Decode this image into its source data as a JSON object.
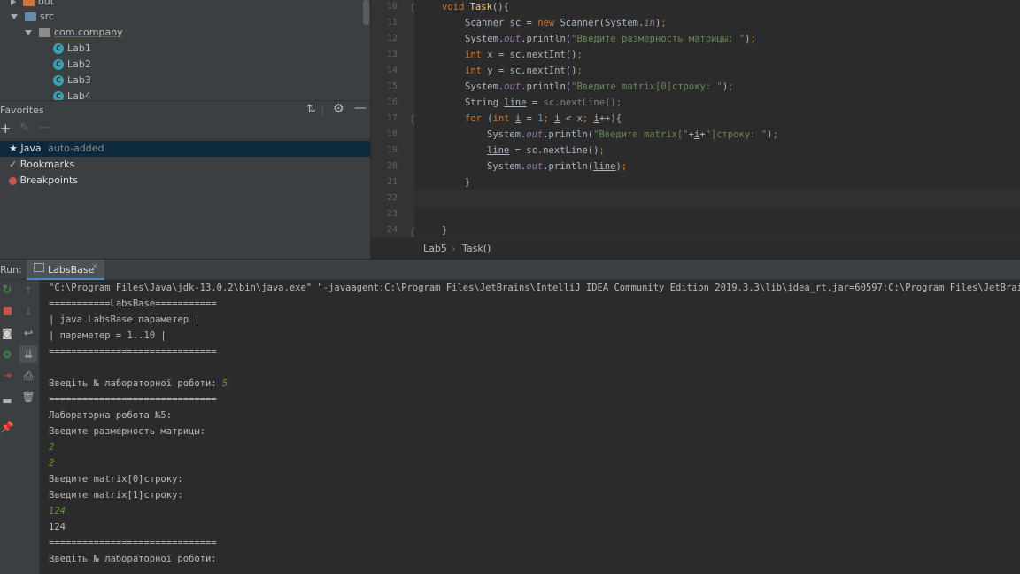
{
  "project_tree": {
    "items": [
      {
        "label": "out",
        "type": "folder-orange",
        "expanded": false
      },
      {
        "label": "src",
        "type": "folder-blue",
        "expanded": true
      },
      {
        "label": "com.company",
        "type": "package",
        "expanded": true
      },
      {
        "label": "Lab1",
        "type": "class"
      },
      {
        "label": "Lab2",
        "type": "class"
      },
      {
        "label": "Lab3",
        "type": "class"
      },
      {
        "label": "Lab4",
        "type": "class"
      }
    ],
    "class_icon_letter": "C"
  },
  "favorites": {
    "title": "Favorites",
    "items": [
      {
        "label": "Java",
        "note": "auto-added",
        "icon": "star-icon",
        "selected": true
      },
      {
        "label": "Bookmarks",
        "icon": "check-icon"
      },
      {
        "label": "Breakpoints",
        "icon": "breakpoint-icon"
      }
    ]
  },
  "editor": {
    "line_numbers": [
      "10",
      "11",
      "12",
      "13",
      "14",
      "15",
      "16",
      "17",
      "18",
      "19",
      "20",
      "21",
      "22",
      "23",
      "24"
    ],
    "breadcrumbs": [
      "Lab5",
      "Task()"
    ]
  },
  "run": {
    "label": "Run:",
    "tab": "LabsBase",
    "console_lines": [
      {
        "text": "\"C:\\Program Files\\Java\\jdk-13.0.2\\bin\\java.exe\" \"-javaagent:C:\\Program Files\\JetBrains\\IntelliJ IDEA Community Edition 2019.3.3\\lib\\idea_rt.jar=60597:C:\\Program Files\\JetBrai"
      },
      {
        "text": "===========LabsBase==========="
      },
      {
        "text": "| java LabsBase параметер |"
      },
      {
        "text": "| параметер = 1..10 |"
      },
      {
        "text": "=============================="
      },
      {
        "text": ""
      },
      {
        "text": "Введіть № лабораторної роботи: ",
        "input": "5"
      },
      {
        "text": "=============================="
      },
      {
        "text": "Лабораторна робота №5:"
      },
      {
        "text": "Введите размерность матрицы:"
      },
      {
        "text": "",
        "input": "2"
      },
      {
        "text": "",
        "input": "2"
      },
      {
        "text": "Введите matrix[0]строку:"
      },
      {
        "text": "Введите matrix[1]строку:"
      },
      {
        "text": "",
        "input": "124"
      },
      {
        "text": "124"
      },
      {
        "text": "=============================="
      },
      {
        "text": "Введіть № лабораторної роботи:"
      }
    ]
  },
  "colors": {
    "keyword": "#cc7832",
    "string": "#6a8759",
    "number": "#6897bb",
    "field": "#9876aa",
    "method_decl": "#ffc66d",
    "user_input": "#62a01f"
  }
}
